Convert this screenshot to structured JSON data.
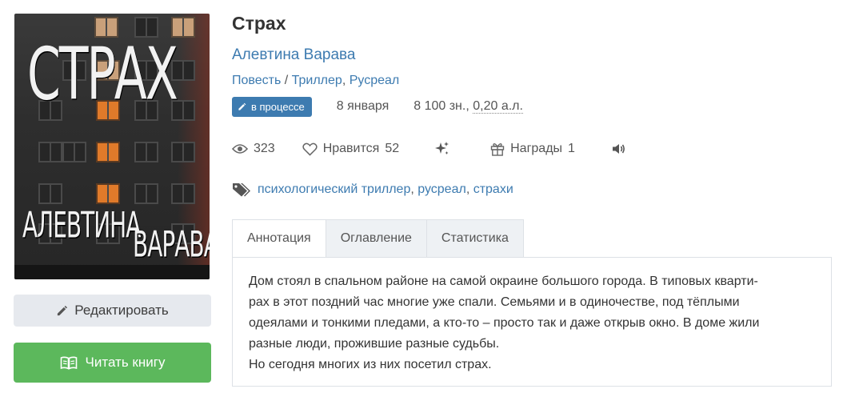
{
  "cover": {
    "title_text": "СТРАХ",
    "author_first": "АЛЕВТИНА",
    "author_last": "ВАРАВА"
  },
  "actions": {
    "edit_label": "Редактировать",
    "read_label": "Читать книгу"
  },
  "book": {
    "title": "Страх",
    "author": "Алевтина Варава",
    "form": "Повесть",
    "genres": [
      "Триллер",
      "Русреал"
    ],
    "status_badge": "в процессе",
    "date": "8 января",
    "size": "8 100 зн.,",
    "size_extra": "0,20 а.л."
  },
  "stats": {
    "views": "323",
    "likes_label": "Нравится",
    "likes": "52",
    "awards_label": "Награды",
    "awards": "1"
  },
  "tags": [
    "психологический триллер",
    "русреал",
    "страхи"
  ],
  "tabs": [
    {
      "label": "Аннотация",
      "active": true
    },
    {
      "label": "Оглавление",
      "active": false
    },
    {
      "label": "Статистика",
      "active": false
    }
  ],
  "annotation": {
    "line1": "Дом стоял в спальном районе на самой окраине большого города. В типовых кварти-",
    "line2": "рах в этот поздний час многие уже спали. Семьями и в одиночестве, под тёплыми",
    "line3": "одеялами и тонкими пледами, а кто-то – просто так и даже открыв окно. В доме жили",
    "line4": "разные люди, прожившие разные судьбы.",
    "line5": "Но сегодня многих из них посетил страх."
  },
  "colors": {
    "accent": "#3d7bb0",
    "read_button": "#5cb85c",
    "edit_button": "#e6e9ee"
  }
}
